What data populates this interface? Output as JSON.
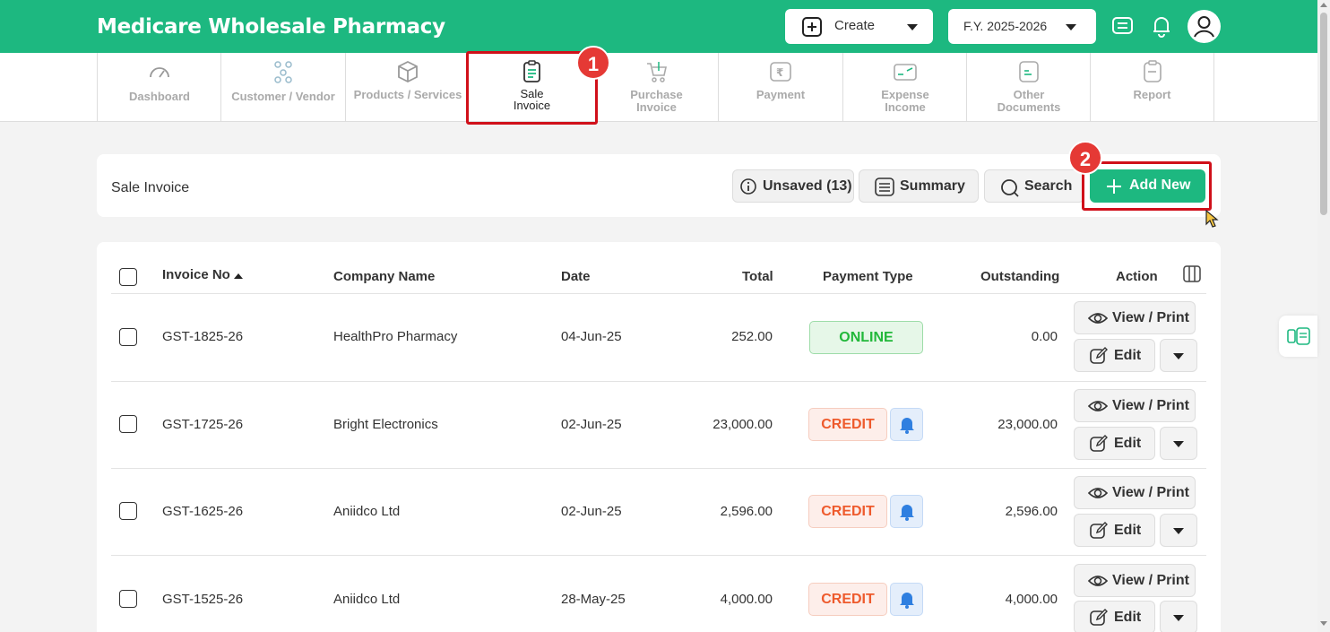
{
  "header": {
    "brand": "Medicare Wholesale Pharmacy",
    "create_label": "Create",
    "fy_label": "F.Y. 2025-2026",
    "brand_color": "#1db880"
  },
  "nav": {
    "items": [
      {
        "label": "Dashboard",
        "icon": "gauge-icon"
      },
      {
        "label": "Customer / Vendor",
        "icon": "people-network-icon"
      },
      {
        "label": "Products / Services",
        "icon": "box-icon"
      },
      {
        "label_line1": "Sale",
        "label_line2": "Invoice",
        "icon": "invoice-icon",
        "active": true
      },
      {
        "label_line1": "Purchase",
        "label_line2": "Invoice",
        "icon": "cart-icon"
      },
      {
        "label": "Payment",
        "icon": "rupee-payment-icon"
      },
      {
        "label_line1": "Expense",
        "label_line2": "Income",
        "icon": "expense-income-icon"
      },
      {
        "label_line1": "Other",
        "label_line2": "Documents",
        "icon": "document-icon"
      },
      {
        "label": "Report",
        "icon": "report-icon"
      }
    ]
  },
  "annotations": {
    "badge1": "1",
    "badge2": "2",
    "highlight_color": "#d0101a"
  },
  "toolbar": {
    "title": "Sale Invoice",
    "unsaved_label": "Unsaved (13)",
    "summary_label": "Summary",
    "search_label": "Search",
    "add_new_label": "Add New"
  },
  "table": {
    "columns": [
      "Invoice No",
      "Company Name",
      "Date",
      "Total",
      "Payment Type",
      "Outstanding",
      "Action"
    ],
    "view_print_label": "View / Print",
    "edit_label": "Edit",
    "rows": [
      {
        "invoice_no": "GST-1825-26",
        "company": "HealthPro Pharmacy",
        "date": "04-Jun-25",
        "total": "252.00",
        "payment_type": "ONLINE",
        "outstanding": "0.00"
      },
      {
        "invoice_no": "GST-1725-26",
        "company": "Bright Electronics",
        "date": "02-Jun-25",
        "total": "23,000.00",
        "payment_type": "CREDIT",
        "outstanding": "23,000.00"
      },
      {
        "invoice_no": "GST-1625-26",
        "company": "Aniidco Ltd",
        "date": "02-Jun-25",
        "total": "2,596.00",
        "payment_type": "CREDIT",
        "outstanding": "2,596.00"
      },
      {
        "invoice_no": "GST-1525-26",
        "company": "Aniidco Ltd",
        "date": "28-May-25",
        "total": "4,000.00",
        "payment_type": "CREDIT",
        "outstanding": "4,000.00"
      }
    ]
  }
}
